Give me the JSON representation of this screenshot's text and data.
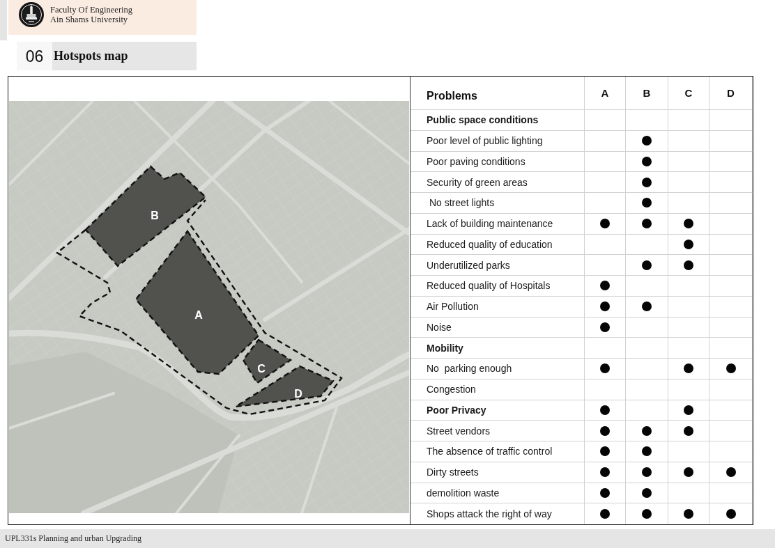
{
  "header": {
    "faculty": "Faculty Of Engineering",
    "university": "Ain Shams University"
  },
  "section": {
    "number": "06",
    "title": "Hotspots map"
  },
  "map": {
    "zones": [
      {
        "label": "A"
      },
      {
        "label": "B"
      },
      {
        "label": "C"
      },
      {
        "label": "D"
      }
    ]
  },
  "problems_table": {
    "heading": "Problems",
    "zone_columns": [
      "A",
      "B",
      "C",
      "D"
    ],
    "rows": [
      {
        "problem": "Public space conditions",
        "bold": true,
        "dots": [
          false,
          false,
          false,
          false
        ]
      },
      {
        "problem": "Poor level of public lighting",
        "bold": false,
        "dots": [
          false,
          true,
          false,
          false
        ]
      },
      {
        "problem": "Poor paving conditions",
        "bold": false,
        "dots": [
          false,
          true,
          false,
          false
        ]
      },
      {
        "problem": "Security of green areas",
        "bold": false,
        "dots": [
          false,
          true,
          false,
          false
        ]
      },
      {
        "problem": " No street lights",
        "bold": false,
        "dots": [
          false,
          true,
          false,
          false
        ]
      },
      {
        "problem": "Lack of building maintenance",
        "bold": false,
        "dots": [
          true,
          true,
          true,
          false
        ]
      },
      {
        "problem": "Reduced quality of education",
        "bold": false,
        "dots": [
          false,
          false,
          true,
          false
        ]
      },
      {
        "problem": "Underutilized parks",
        "bold": false,
        "dots": [
          false,
          true,
          true,
          false
        ]
      },
      {
        "problem": "Reduced quality of Hospitals",
        "bold": false,
        "dots": [
          true,
          false,
          false,
          false
        ]
      },
      {
        "problem": "Air Pollution",
        "bold": false,
        "dots": [
          true,
          true,
          false,
          false
        ]
      },
      {
        "problem": "Noise",
        "bold": false,
        "dots": [
          true,
          false,
          false,
          false
        ]
      },
      {
        "problem": "Mobility",
        "bold": true,
        "dots": [
          false,
          false,
          false,
          false
        ]
      },
      {
        "problem": "No  parking enough",
        "bold": false,
        "dots": [
          true,
          false,
          true,
          true
        ]
      },
      {
        "problem": "Congestion",
        "bold": false,
        "dots": [
          false,
          false,
          false,
          false
        ]
      },
      {
        "problem": "Poor Privacy",
        "bold": true,
        "dots": [
          true,
          false,
          true,
          false
        ]
      },
      {
        "problem": "Street vendors",
        "bold": false,
        "dots": [
          true,
          true,
          true,
          false
        ]
      },
      {
        "problem": "The absence of traffic control",
        "bold": false,
        "dots": [
          true,
          true,
          false,
          false
        ]
      },
      {
        "problem": "Dirty streets",
        "bold": false,
        "dots": [
          true,
          true,
          true,
          true
        ]
      },
      {
        "problem": "demolition waste",
        "bold": false,
        "dots": [
          true,
          true,
          false,
          false
        ]
      },
      {
        "problem": "Shops attack the right of way",
        "bold": false,
        "dots": [
          true,
          true,
          true,
          true
        ]
      }
    ]
  },
  "footer": {
    "course": "UPL331s Planning and urban Upgrading"
  }
}
